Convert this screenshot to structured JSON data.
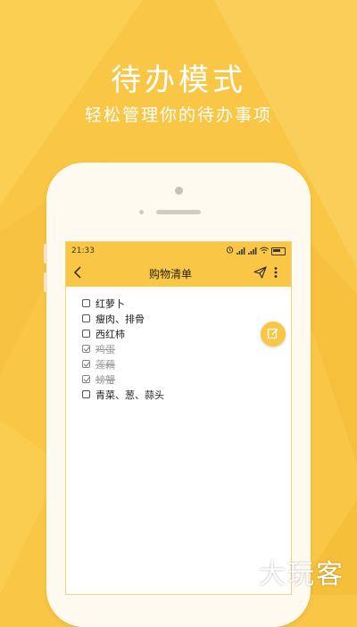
{
  "promo": {
    "headline": "待办模式",
    "subline": "轻松管理你的待办事项"
  },
  "status_bar": {
    "time": "21:33"
  },
  "app_bar": {
    "title": "购物清单",
    "back_icon": "chevron-left-icon",
    "share_icon": "send-icon",
    "more_icon": "more-vertical-icon"
  },
  "todo_list": [
    {
      "label": "红萝卜",
      "checked": false
    },
    {
      "label": "瘦肉、排骨",
      "checked": false
    },
    {
      "label": "西红柿",
      "checked": false
    },
    {
      "label": "鸡蛋",
      "checked": true
    },
    {
      "label": "莲藕",
      "checked": true
    },
    {
      "label": "螃蟹",
      "checked": true
    },
    {
      "label": "青菜、葱、蒜头",
      "checked": false
    }
  ],
  "fab": {
    "icon": "edit-icon"
  },
  "watermark": "大玩客",
  "colors": {
    "background": "#f9c745",
    "accent": "#f9c745",
    "phone_body": "#fffaf0"
  }
}
